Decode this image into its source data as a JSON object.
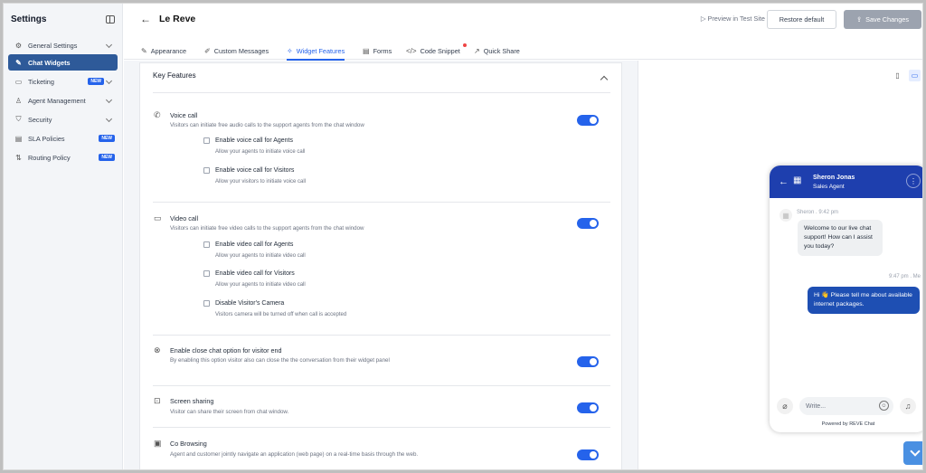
{
  "sidebar": {
    "title": "Settings",
    "items": [
      {
        "label": "General Settings",
        "icon": "gear-icon"
      },
      {
        "label": "Chat Widgets",
        "icon": "tools-icon"
      },
      {
        "label": "Ticketing",
        "icon": "ticket-icon",
        "badge": "NEW"
      },
      {
        "label": "Agent Management",
        "icon": "user-icon"
      },
      {
        "label": "Security",
        "icon": "shield-icon"
      },
      {
        "label": "SLA Policies",
        "icon": "document-icon",
        "badge": "NEW"
      },
      {
        "label": "Routing Policy",
        "icon": "route-icon",
        "badge": "NEW"
      }
    ]
  },
  "header": {
    "title": "Le Reve",
    "preview_label": "Preview in Test Site",
    "restore_label": "Restore default",
    "save_label": "Save Changes"
  },
  "tabs": [
    {
      "label": "Appearance",
      "icon": "brush-icon"
    },
    {
      "label": "Custom Messages",
      "icon": "edit-icon"
    },
    {
      "label": "Widget Features",
      "icon": "widget-icon"
    },
    {
      "label": "Forms",
      "icon": "form-icon"
    },
    {
      "label": "Code Snippet",
      "icon": "code-icon"
    },
    {
      "label": "Quick Share",
      "icon": "share-icon"
    }
  ],
  "features": {
    "section_title": "Key Features",
    "voice_call": {
      "title": "Voice call",
      "desc": "Visitors can initiate free audio calls to the support agents from the chat window",
      "opt1_title": "Enable voice call for Agents",
      "opt1_desc": "Allow your agents to initiate voice call",
      "opt2_title": "Enable voice call for Visitors",
      "opt2_desc": "Allow your visitors to initiate voice call"
    },
    "video_call": {
      "title": "Video call",
      "desc": "Visitors can initiate free video calls to the support agents from the chat window",
      "opt1_title": "Enable video call for Agents",
      "opt1_desc": "Allow your agents to initiate video call",
      "opt2_title": "Enable video call for Visitors",
      "opt2_desc": "Allow your agents to initiate video call",
      "opt3_title": "Disable Visitor's Camera",
      "opt3_desc": "Visitors camera will be turned off when call is accepted"
    },
    "close_chat": {
      "title": "Enable close chat option for visitor end",
      "desc": "By enabling this option visitor also can close the the conversation from their widget panel"
    },
    "screen_sharing": {
      "title": "Screen sharing",
      "desc": "Visitor can share their screen from chat window."
    },
    "co_browsing": {
      "title": "Co Browsing",
      "desc": "Agent and customer jointly navigate an application (web page) on a real-time basis through the web."
    }
  },
  "widget": {
    "agent_name": "Sheron Jonas",
    "agent_role": "Sales Agent",
    "msg1_meta": "Sheron . 9:42 pm",
    "msg1_text": "Welcome to our live chat support! How can I assist you today?",
    "msg2_meta": "9:47 pm . Me",
    "msg2_text": "Hi 👋 Please tell me about available internet packages.",
    "input_placeholder": "Write...",
    "powered_by": "Powered by REVE Chat"
  }
}
